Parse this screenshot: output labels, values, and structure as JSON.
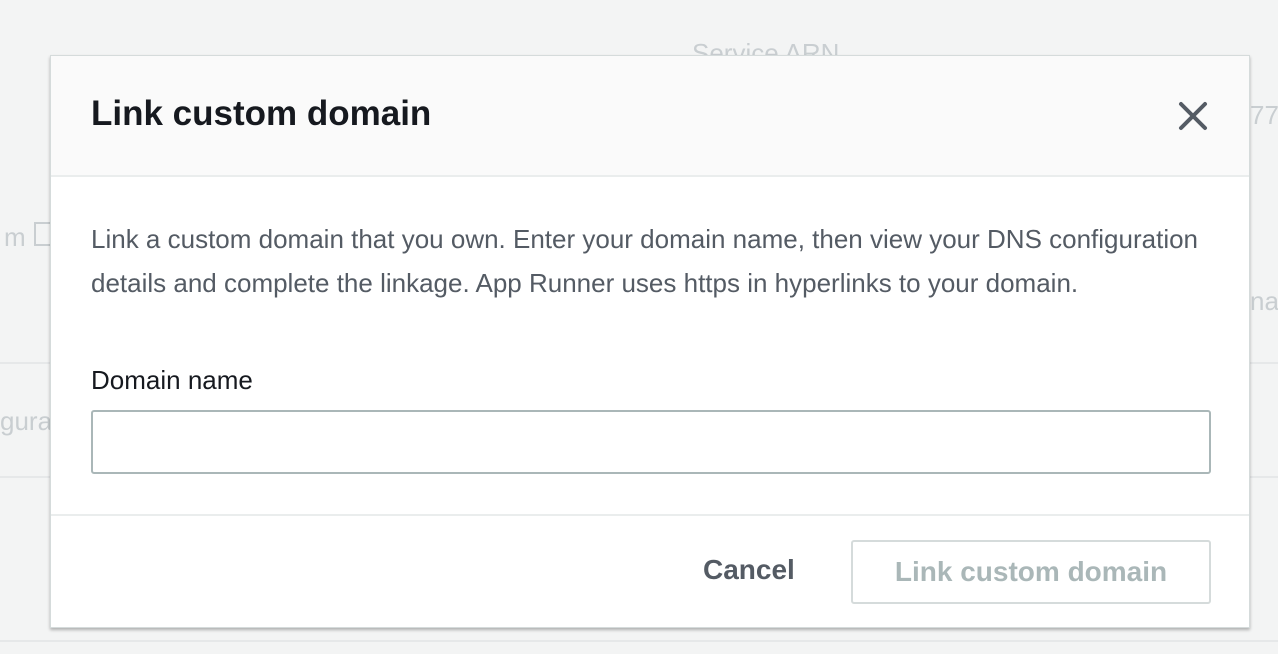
{
  "background": {
    "service_arn_label": "Service ARN",
    "arn_fragment": "77",
    "left_fragment_1": "m",
    "left_fragment_2": "gura",
    "right_fragment": "na",
    "external_link_icon": "external-link-icon"
  },
  "modal": {
    "title": "Link custom domain",
    "close_icon": "close-icon",
    "description": "Link a custom domain that you own. Enter your domain name, then view your DNS configuration details and complete the linkage. App Runner uses https in hyperlinks to your domain.",
    "domain_field": {
      "label": "Domain name",
      "value": "",
      "placeholder": ""
    },
    "footer": {
      "cancel_label": "Cancel",
      "submit_label": "Link custom domain",
      "submit_disabled": true
    }
  },
  "colors": {
    "title": "#16191f",
    "body_text": "#545b64",
    "disabled_text": "#aab7b8",
    "border": "#d5dbdb"
  }
}
